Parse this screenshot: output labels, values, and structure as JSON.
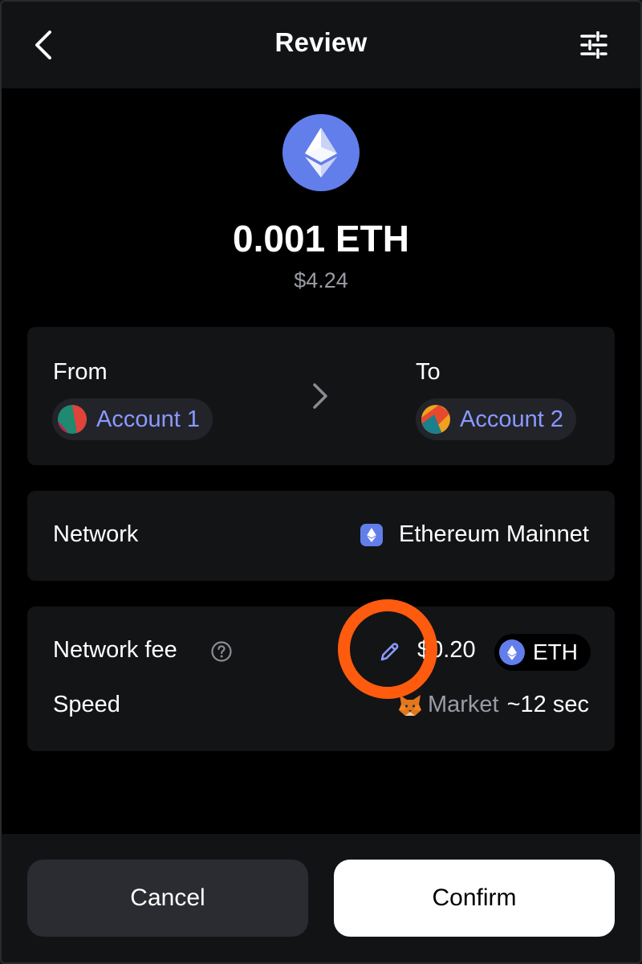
{
  "header": {
    "title": "Review",
    "back_icon": "chevron-left-icon",
    "settings_icon": "sliders-icon"
  },
  "token": {
    "icon": "ethereum-icon",
    "amount": "0.001 ETH",
    "fiat": "$4.24"
  },
  "accounts": {
    "from_label": "From",
    "from_account": "Account 1",
    "to_label": "To",
    "to_account": "Account 2"
  },
  "network": {
    "label": "Network",
    "value": "Ethereum Mainnet"
  },
  "fee": {
    "label": "Network fee",
    "value": "$0.20",
    "currency": "ETH",
    "speed_label": "Speed",
    "speed_value": "Market",
    "speed_time": "~12 sec"
  },
  "footer": {
    "cancel_label": "Cancel",
    "confirm_label": "Confirm"
  },
  "colors": {
    "background": "#000000",
    "card": "#131416",
    "accent": "#8b99ff",
    "eth": "#627eea",
    "highlight": "#ff5b0f"
  }
}
